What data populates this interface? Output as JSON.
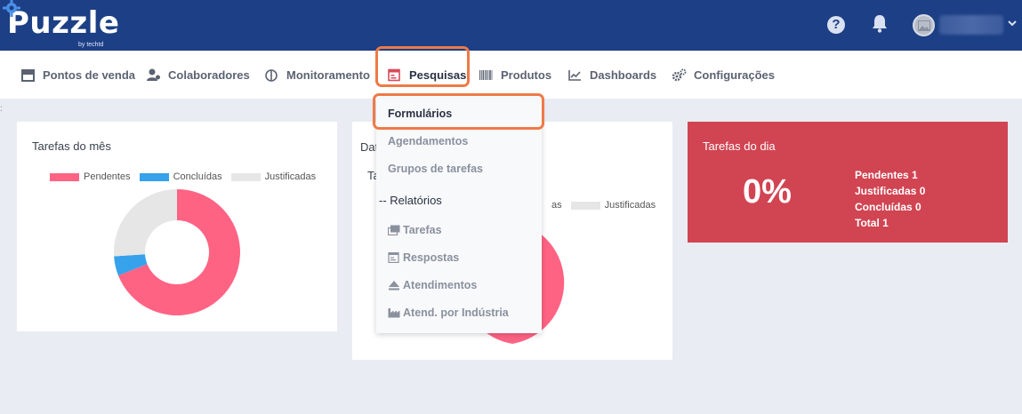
{
  "header": {
    "logo_text": "Puzzle",
    "logo_sub": "by techtd",
    "help_glyph": "?"
  },
  "nav": {
    "items": [
      {
        "label": "Pontos de venda",
        "icon": "store-icon"
      },
      {
        "label": "Colaboradores",
        "icon": "users-icon"
      },
      {
        "label": "Monitoramento",
        "icon": "monitor-icon"
      },
      {
        "label": "Pesquisas",
        "icon": "survey-icon"
      },
      {
        "label": "Produtos",
        "icon": "barcode-icon"
      },
      {
        "label": "Dashboards",
        "icon": "chart-line-icon"
      },
      {
        "label": "Configurações",
        "icon": "gears-icon"
      }
    ]
  },
  "dropdown": {
    "items": [
      {
        "label": "Formulários"
      },
      {
        "label": "Agendamentos"
      },
      {
        "label": "Grupos de tarefas"
      }
    ],
    "section_label": "-- Relatórios",
    "sub_items": [
      {
        "label": "Tarefas",
        "icon": "tasks-icon"
      },
      {
        "label": "Respostas",
        "icon": "answers-icon"
      },
      {
        "label": "Atendimentos",
        "icon": "eject-icon"
      },
      {
        "label": "Atend. por Indústria",
        "icon": "industry-icon"
      }
    ]
  },
  "card_month": {
    "title": "Tarefas do mês",
    "legend": [
      "Pendentes",
      "Concluídas",
      "Justificadas"
    ]
  },
  "card_date": {
    "title_visible": "Dat",
    "sub_visible": "Ta",
    "legend_visible": [
      "as",
      "Justificadas"
    ]
  },
  "card_day": {
    "title": "Tarefas do dia",
    "percent": "0%",
    "stats": [
      "Pendentes 1",
      "Justificadas 0",
      "Concluídas 0",
      "Total 1"
    ]
  },
  "colors": {
    "topbar": "#1c3f85",
    "pendentes": "#ff6384",
    "concluidas": "#36a2eb",
    "justificadas": "#e6e6e6",
    "day_card": "#d14452",
    "highlight": "#ee7a47"
  },
  "chart_data": [
    {
      "type": "pie",
      "title": "Tarefas do mês",
      "categories": [
        "Pendentes",
        "Concluídas",
        "Justificadas"
      ],
      "values": [
        69,
        5,
        26
      ],
      "donut": true
    }
  ]
}
